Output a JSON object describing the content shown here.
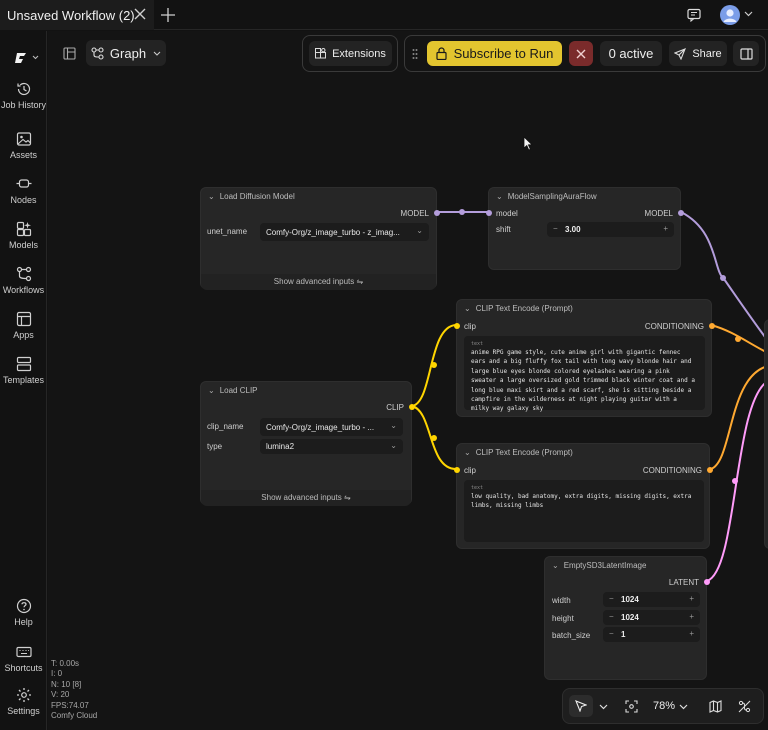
{
  "tab": {
    "title": "Unsaved Workflow (2)"
  },
  "toolbar": {
    "graph_label": "Graph",
    "extensions_label": "Extensions",
    "subscribe_label": "Subscribe to Run",
    "active_label": "0 active",
    "share_label": "Share"
  },
  "sidebar": {
    "items": [
      {
        "label": "Job History",
        "icon": "history-icon"
      },
      {
        "label": "Assets",
        "icon": "image-icon"
      },
      {
        "label": "Nodes",
        "icon": "node-icon"
      },
      {
        "label": "Models",
        "icon": "models-icon"
      },
      {
        "label": "Workflows",
        "icon": "workflow-icon"
      },
      {
        "label": "Apps",
        "icon": "apps-icon"
      },
      {
        "label": "Templates",
        "icon": "templates-icon"
      }
    ],
    "bottom": [
      {
        "label": "Help",
        "icon": "help-icon"
      },
      {
        "label": "Shortcuts",
        "icon": "keyboard-icon"
      },
      {
        "label": "Settings",
        "icon": "gear-icon"
      }
    ]
  },
  "nodes": {
    "load_diffusion": {
      "title": "Load Diffusion Model",
      "output": "MODEL",
      "unet_label": "unet_name",
      "unet_value": "Comfy-Org/z_image_turbo - z_imag...",
      "advanced": "Show advanced inputs"
    },
    "model_sampling": {
      "title": "ModelSamplingAuraFlow",
      "input": "model",
      "output": "MODEL",
      "shift_label": "shift",
      "shift_value": "3.00"
    },
    "clip_pos": {
      "title": "CLIP Text Encode (Prompt)",
      "input": "clip",
      "output": "CONDITIONING",
      "text_label": "text",
      "text": "anime RPG game style, cute anime girl with gigantic fennec ears and a big fluffy fox tail with long wavy blonde hair and large blue eyes blonde colored eyelashes wearing a pink sweater a large oversized gold trimmed black winter coat and a long blue maxi skirt and a red scarf, she is sitting beside a campfire in the wilderness at night playing guitar with a milky way galaxy sky"
    },
    "load_clip": {
      "title": "Load CLIP",
      "output": "CLIP",
      "clip_label": "clip_name",
      "clip_value": "Comfy-Org/z_image_turbo - ...",
      "type_label": "type",
      "type_value": "lumina2",
      "advanced": "Show advanced inputs"
    },
    "clip_neg": {
      "title": "CLIP Text Encode (Prompt)",
      "input": "clip",
      "output": "CONDITIONING",
      "text_label": "text",
      "text": "low quality, bad anatomy, extra digits, missing digits, extra limbs, missing limbs"
    },
    "latent": {
      "title": "EmptySD3LatentImage",
      "output": "LATENT",
      "width_label": "width",
      "width_value": "1024",
      "height_label": "height",
      "height_value": "1024",
      "batch_label": "batch_size",
      "batch_value": "1"
    }
  },
  "stats": {
    "t": "T: 0.00s",
    "i": "I: 0",
    "n": "N: 10 [8]",
    "v": "V: 20",
    "fps": "FPS:74.07",
    "env": "Comfy Cloud"
  },
  "zoom": {
    "level": "78%"
  },
  "colors": {
    "model_link": "#b39ddb",
    "clip_link": "#ffd500",
    "conditioning_link": "#ffa931",
    "latent_link": "#ff9cf9",
    "subscribe_bg": "#e3c52f",
    "close_bg": "#7a2b2b"
  }
}
